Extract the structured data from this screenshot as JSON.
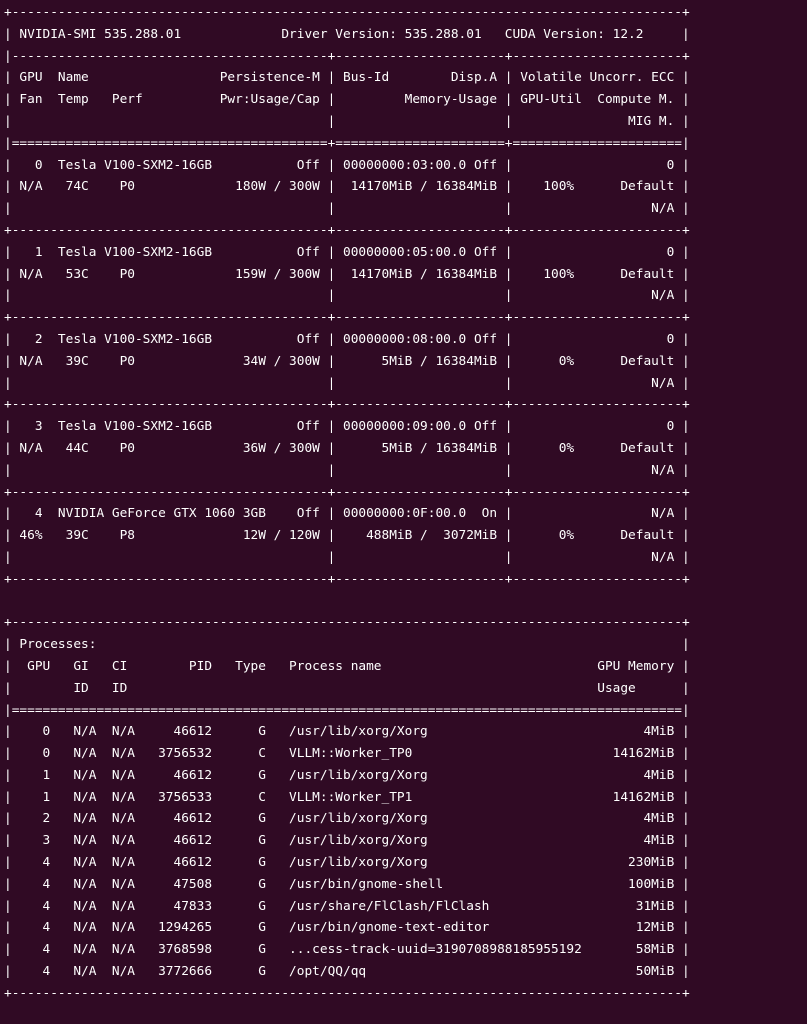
{
  "terminal": {
    "lines": [
      "+---------------------------------------------------------------------------------------+",
      "| NVIDIA-SMI 535.288.01             Driver Version: 535.288.01   CUDA Version: 12.2     |",
      "|-----------------------------------------+----------------------+----------------------+",
      "| GPU  Name                 Persistence-M | Bus-Id        Disp.A | Volatile Uncorr. ECC |",
      "| Fan  Temp   Perf          Pwr:Usage/Cap |         Memory-Usage | GPU-Util  Compute M. |",
      "|                                         |                      |               MIG M. |",
      "|=========================================+======================+======================|",
      "|   0  Tesla V100-SXM2-16GB           Off | 00000000:03:00.0 Off |                    0 |",
      "| N/A   74C    P0             180W / 300W |  14170MiB / 16384MiB |    100%      Default |",
      "|                                         |                      |                  N/A |",
      "+-----------------------------------------+----------------------+----------------------+",
      "|   1  Tesla V100-SXM2-16GB           Off | 00000000:05:00.0 Off |                    0 |",
      "| N/A   53C    P0             159W / 300W |  14170MiB / 16384MiB |    100%      Default |",
      "|                                         |                      |                  N/A |",
      "+-----------------------------------------+----------------------+----------------------+",
      "|   2  Tesla V100-SXM2-16GB           Off | 00000000:08:00.0 Off |                    0 |",
      "| N/A   39C    P0              34W / 300W |      5MiB / 16384MiB |      0%      Default |",
      "|                                         |                      |                  N/A |",
      "+-----------------------------------------+----------------------+----------------------+",
      "|   3  Tesla V100-SXM2-16GB           Off | 00000000:09:00.0 Off |                    0 |",
      "| N/A   44C    P0              36W / 300W |      5MiB / 16384MiB |      0%      Default |",
      "|                                         |                      |                  N/A |",
      "+-----------------------------------------+----------------------+----------------------+",
      "|   4  NVIDIA GeForce GTX 1060 3GB    Off | 00000000:0F:00.0  On |                  N/A |",
      "| 46%   39C    P8              12W / 120W |    488MiB /  3072MiB |      0%      Default |",
      "|                                         |                      |                  N/A |",
      "+-----------------------------------------+----------------------+----------------------+",
      "",
      "+---------------------------------------------------------------------------------------+",
      "| Processes:                                                                            |",
      "|  GPU   GI   CI        PID   Type   Process name                            GPU Memory |",
      "|        ID   ID                                                             Usage      |",
      "|=======================================================================================|",
      "|    0   N/A  N/A     46612      G   /usr/lib/xorg/Xorg                            4MiB |",
      "|    0   N/A  N/A   3756532      C   VLLM::Worker_TP0                          14162MiB |",
      "|    1   N/A  N/A     46612      G   /usr/lib/xorg/Xorg                            4MiB |",
      "|    1   N/A  N/A   3756533      C   VLLM::Worker_TP1                          14162MiB |",
      "|    2   N/A  N/A     46612      G   /usr/lib/xorg/Xorg                            4MiB |",
      "|    3   N/A  N/A     46612      G   /usr/lib/xorg/Xorg                            4MiB |",
      "|    4   N/A  N/A     46612      G   /usr/lib/xorg/Xorg                          230MiB |",
      "|    4   N/A  N/A     47508      G   /usr/bin/gnome-shell                        100MiB |",
      "|    4   N/A  N/A     47833      G   /usr/share/FlClash/FlClash                   31MiB |",
      "|    4   N/A  N/A   1294265      G   /usr/bin/gnome-text-editor                   12MiB |",
      "|    4   N/A  N/A   3768598      G   ...cess-track-uuid=3190708988185955192       58MiB |",
      "|    4   N/A  N/A   3772666      G   /opt/QQ/qq                                   50MiB |",
      "+---------------------------------------------------------------------------------------+"
    ]
  }
}
